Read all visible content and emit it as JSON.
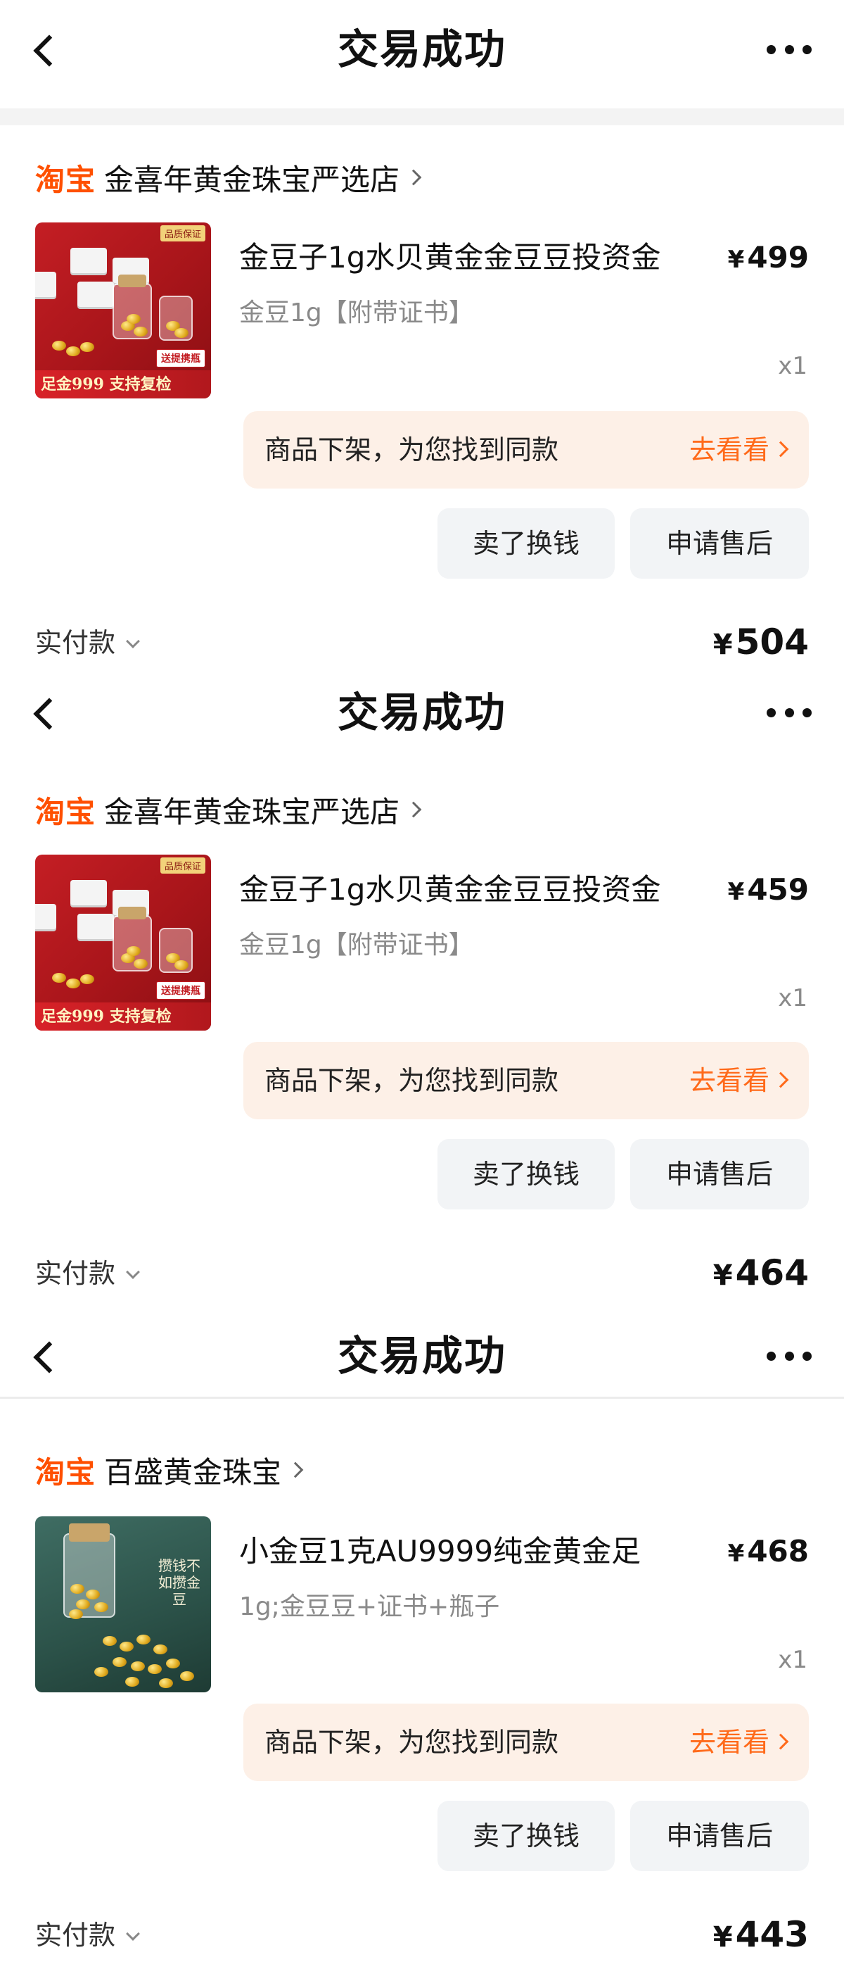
{
  "header": {
    "title": "交易成功"
  },
  "orders": [
    {
      "tb_logo": "淘宝",
      "shop_name": "金喜年黄金珠宝严选店",
      "image_top_badge": "品质保证",
      "image_corner_badge": "送提携瓶",
      "image_banner": "足金999 支持复检",
      "product_title": "金豆子1g水贝黄金金豆豆投资金",
      "currency": "¥",
      "price": "499",
      "spec": "金豆1g【附带证书】",
      "quantity": "x1",
      "notice_text": "商品下架，为您找到同款",
      "notice_link": "去看看",
      "sell_button": "卖了换钱",
      "service_button": "申请售后",
      "paid_label": "实付款",
      "paid_amount": "504"
    },
    {
      "tb_logo": "淘宝",
      "shop_name": "金喜年黄金珠宝严选店",
      "image_top_badge": "品质保证",
      "image_corner_badge": "送提携瓶",
      "image_banner": "足金999 支持复检",
      "product_title": "金豆子1g水贝黄金金豆豆投资金",
      "currency": "¥",
      "price": "459",
      "spec": "金豆1g【附带证书】",
      "quantity": "x1",
      "notice_text": "商品下架，为您找到同款",
      "notice_link": "去看看",
      "sell_button": "卖了换钱",
      "service_button": "申请售后",
      "paid_label": "实付款",
      "paid_amount": "464"
    },
    {
      "tb_logo": "淘宝",
      "shop_name": "百盛黄金珠宝",
      "image_note": "攒钱不如攒金豆",
      "product_title": "小金豆1克AU9999纯金黄金足",
      "currency": "¥",
      "price": "468",
      "spec": "1g;金豆豆+证书+瓶子",
      "quantity": "x1",
      "notice_text": "商品下架，为您找到同款",
      "notice_link": "去看看",
      "sell_button": "卖了换钱",
      "service_button": "申请售后",
      "paid_label": "实付款",
      "paid_amount": "443"
    }
  ],
  "colors": {
    "brand_orange": "#ff5000",
    "notice_bg": "#fdf0e7",
    "link_orange": "#ff6a1a",
    "button_bg": "#f2f4f6"
  }
}
